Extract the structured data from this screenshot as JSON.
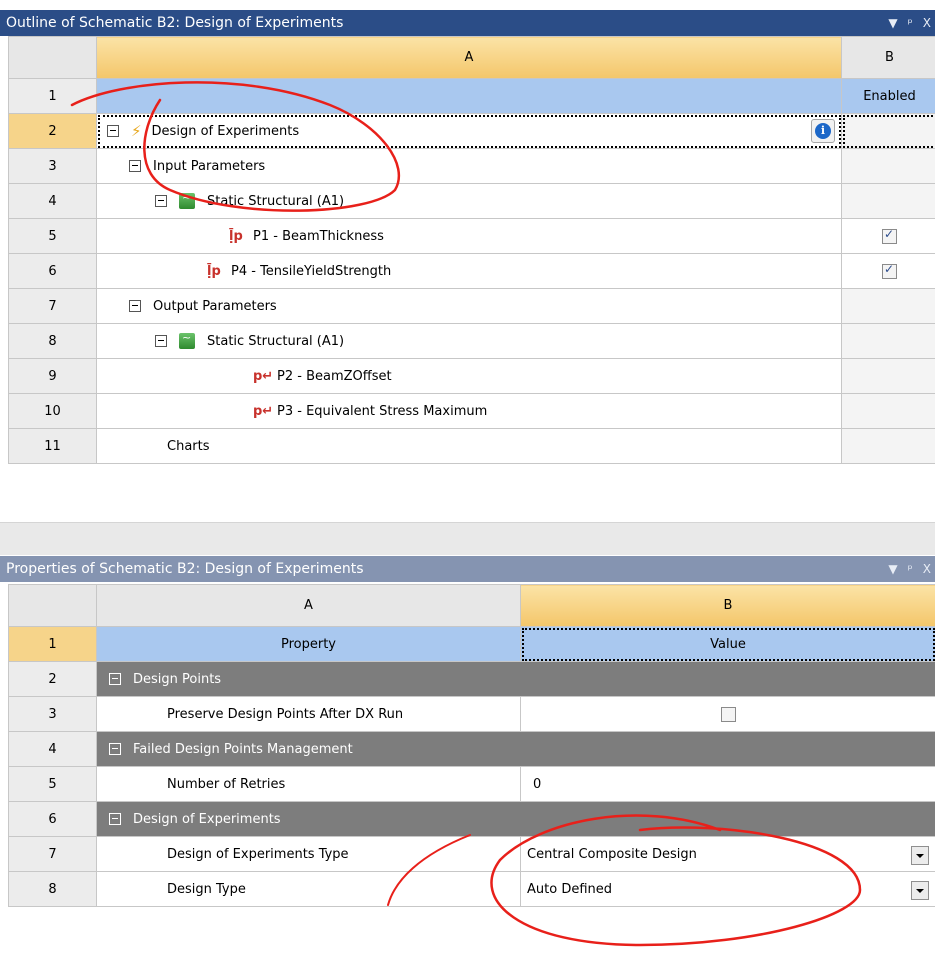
{
  "outline": {
    "title": "Outline of Schematic B2: Design of Experiments",
    "ctrl_dropdown": "▼",
    "ctrl_pin": "ᵖ",
    "ctrl_close": "X",
    "col_a": "A",
    "col_b": "B",
    "rows": [
      {
        "num": "1",
        "label": "",
        "b": "Enabled"
      },
      {
        "num": "2",
        "label": "Design of Experiments",
        "b": ""
      },
      {
        "num": "3",
        "label": "Input Parameters",
        "b": ""
      },
      {
        "num": "4",
        "label": "Static Structural (A1)",
        "b": ""
      },
      {
        "num": "5",
        "label": "P1 - BeamThickness",
        "b": "checked"
      },
      {
        "num": "6",
        "label": "P4 - TensileYieldStrength",
        "b": "checked"
      },
      {
        "num": "7",
        "label": "Output Parameters",
        "b": ""
      },
      {
        "num": "8",
        "label": "Static Structural (A1)",
        "b": ""
      },
      {
        "num": "9",
        "label": "P2 - BeamZOffset",
        "b": ""
      },
      {
        "num": "10",
        "label": "P3 - Equivalent Stress Maximum",
        "b": ""
      },
      {
        "num": "11",
        "label": "Charts",
        "b": ""
      }
    ],
    "info_glyph": "i"
  },
  "properties": {
    "title": "Properties of Schematic B2: Design of Experiments",
    "ctrl_dropdown": "▼",
    "ctrl_pin": "ᵖ",
    "ctrl_close": "X",
    "col_a": "A",
    "col_b": "B",
    "rows": [
      {
        "num": "1",
        "a": "Property",
        "b": "Value"
      },
      {
        "num": "2",
        "a": "Design Points",
        "b": ""
      },
      {
        "num": "3",
        "a": "Preserve Design Points After DX Run",
        "b": ""
      },
      {
        "num": "4",
        "a": "Failed Design Points Management",
        "b": ""
      },
      {
        "num": "5",
        "a": "Number of Retries",
        "b": "0"
      },
      {
        "num": "6",
        "a": "Design of Experiments",
        "b": ""
      },
      {
        "num": "7",
        "a": "Design of Experiments Type",
        "b": "Central Composite Design"
      },
      {
        "num": "8",
        "a": "Design Type",
        "b": "Auto Defined"
      }
    ]
  },
  "colors": {
    "accent_title": "#2b4d87",
    "inactive_title": "#8594b1",
    "annotation": "#e8201a",
    "header_blue": "#a9c8ef",
    "selection": "#f6d48a"
  }
}
